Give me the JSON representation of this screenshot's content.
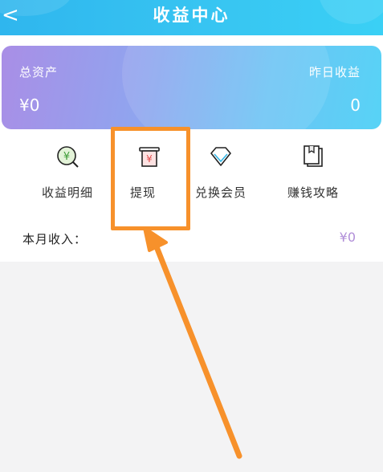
{
  "header": {
    "title": "收益中心",
    "back_icon": "chevron-left-icon",
    "back_glyph": "<"
  },
  "summary": {
    "total_assets_label": "总资产",
    "total_assets_value": "¥0",
    "yesterday_earnings_label": "昨日收益",
    "yesterday_earnings_value": "0"
  },
  "menu": {
    "items": [
      {
        "label": "收益明细",
        "icon": "yuan-magnifier-icon"
      },
      {
        "label": "提现",
        "icon": "yuan-withdraw-icon"
      },
      {
        "label": "兑换会员",
        "icon": "diamond-icon"
      },
      {
        "label": "赚钱攻略",
        "icon": "guide-book-icon"
      }
    ]
  },
  "income": {
    "label": "本月收入：",
    "value": "¥0"
  },
  "colors": {
    "header": "#38c6f2",
    "highlight": "#f7912b",
    "income_value": "#b08ed8"
  }
}
